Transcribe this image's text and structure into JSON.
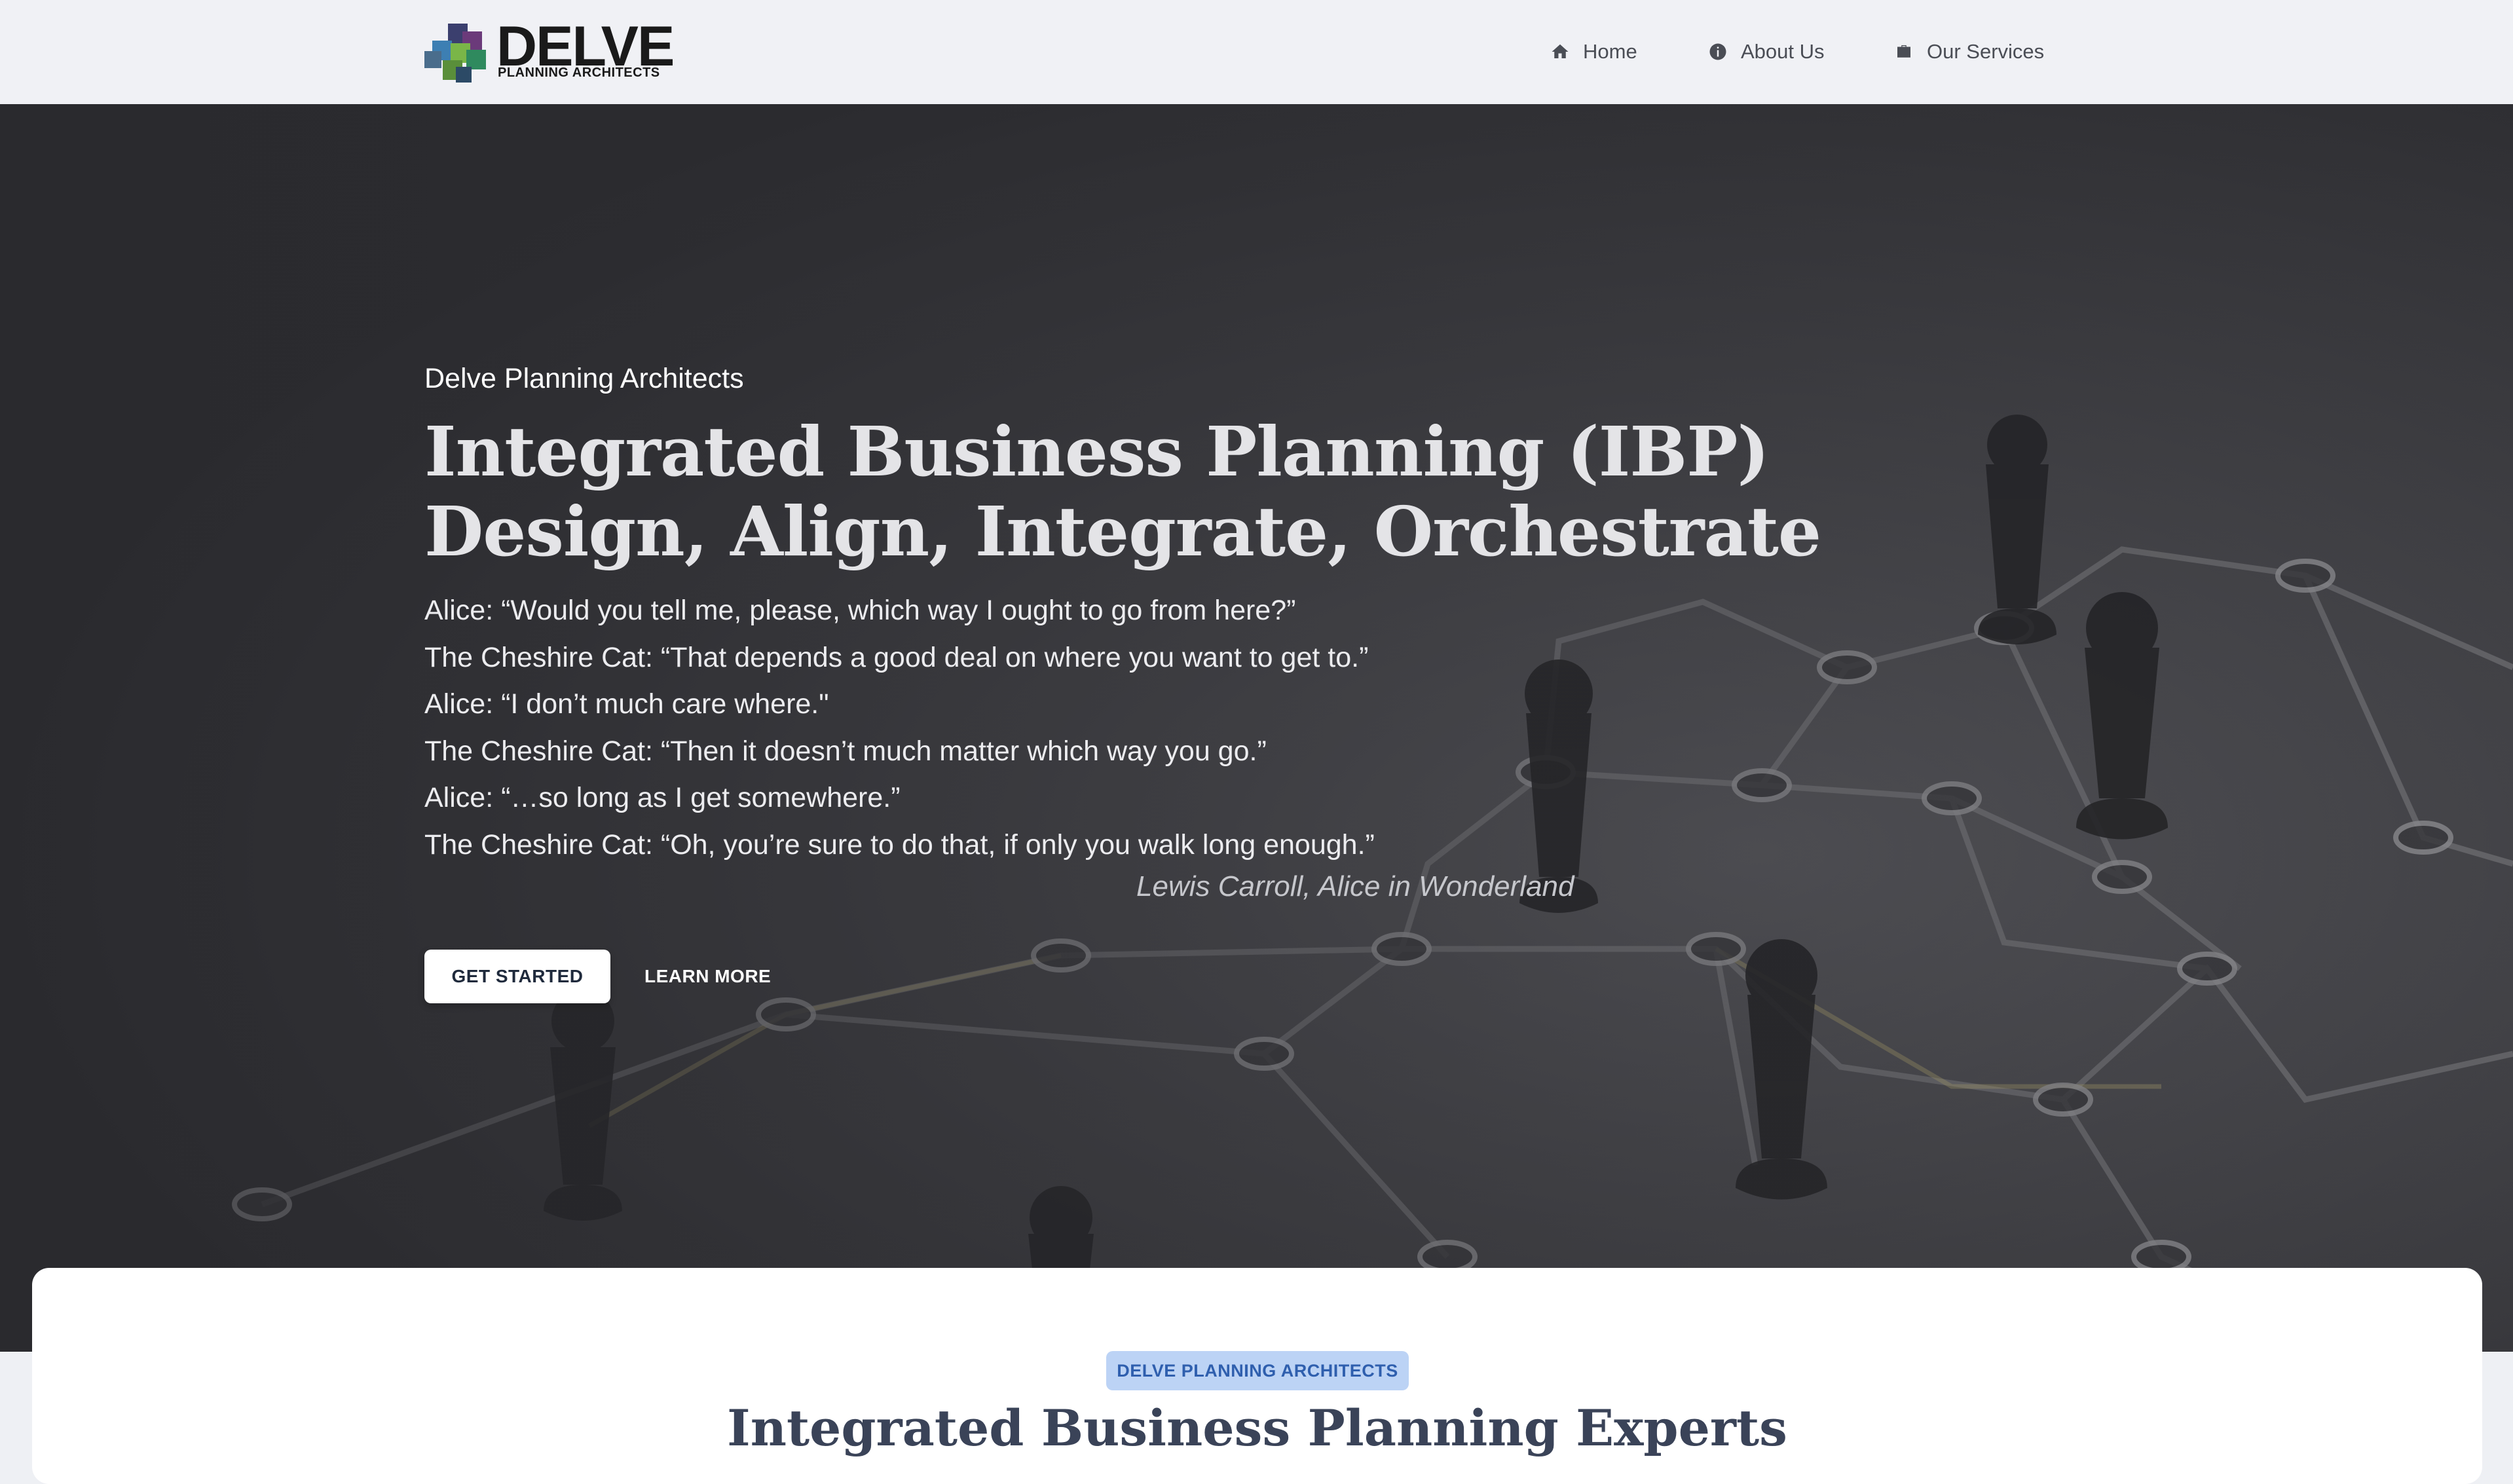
{
  "brand": {
    "name": "DELVE",
    "tagline": "PLANNING ARCHITECTS"
  },
  "nav": {
    "items": [
      {
        "label": "Home",
        "icon": "home-icon"
      },
      {
        "label": "About Us",
        "icon": "info-icon"
      },
      {
        "label": "Our Services",
        "icon": "briefcase-icon"
      }
    ]
  },
  "hero": {
    "eyebrow": "Delve Planning Architects",
    "title_line1": "Integrated Business Planning (IBP)",
    "title_line2": "Design, Align, Integrate, Orchestrate",
    "quote": [
      "Alice: “Would you tell me, please, which way I ought to go from here?”",
      "The Cheshire Cat: “That depends a good deal on where you want to get to.”",
      "Alice: “I don’t much care where.\"",
      "The Cheshire Cat: “Then it doesn’t much matter which way you go.”",
      "Alice: “…so long as I get somewhere.”",
      "The Cheshire Cat: “Oh, you’re sure to do that, if only you walk long enough.”"
    ],
    "attribution": "Lewis Carroll, Alice in Wonderland",
    "primary_button": "GET STARTED",
    "secondary_button": "LEARN MORE"
  },
  "intro": {
    "badge": "DELVE PLANNING ARCHITECTS",
    "title": "Integrated Business Planning Experts"
  },
  "colors": {
    "nav_bg": "#f0f1f5",
    "hero_bg": "#3f3f44",
    "badge_bg": "#bcd3f5",
    "badge_text": "#2f5fae",
    "title_text": "#3a4358"
  }
}
